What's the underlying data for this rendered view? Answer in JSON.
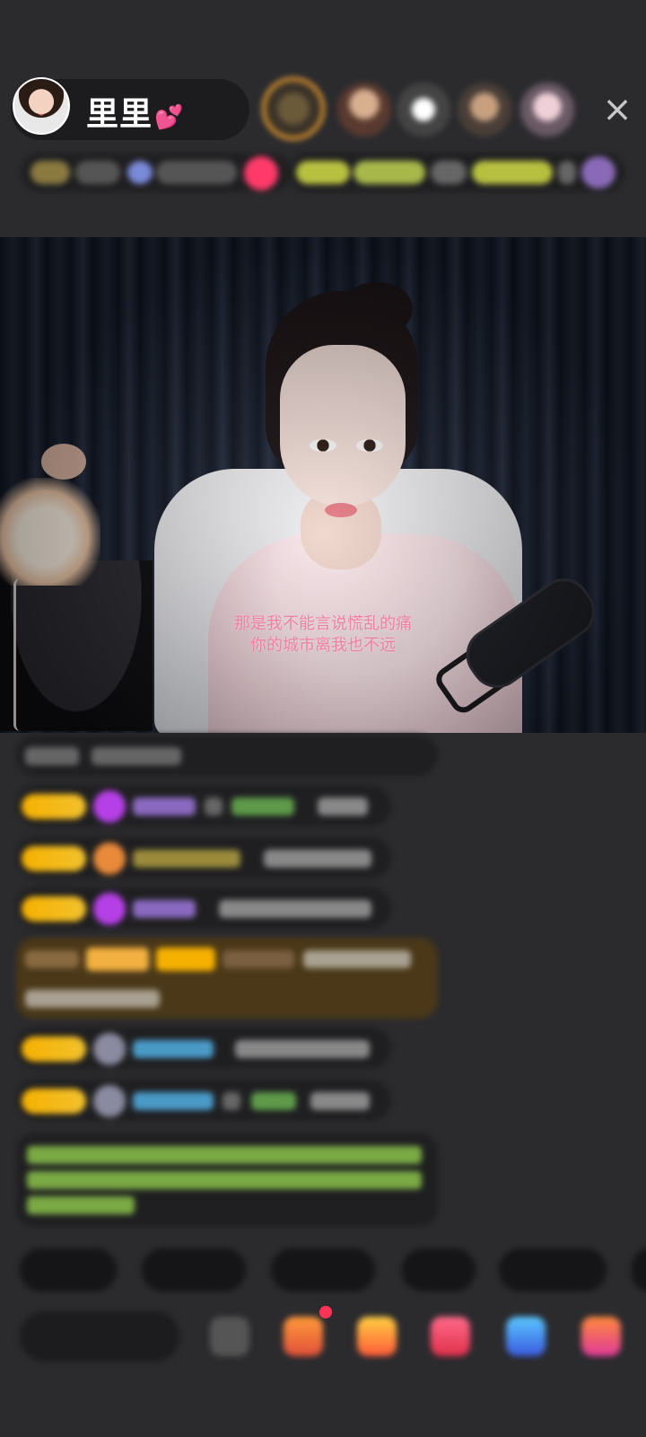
{
  "header": {
    "host_name": "里里",
    "host_name_emoji": "💕",
    "close_label": "×"
  },
  "video": {
    "lyrics": [
      "那是我不能言说慌乱的痛",
      "你的城市离我也不远"
    ]
  },
  "colors": {
    "background": "#2b2b2e",
    "level_badge": "#f6b100",
    "lyric_pink": "#f07fa6",
    "system_message_green": "#8bc34a",
    "gift_row_brown": "#4a3818"
  },
  "icons": {
    "close": "close-icon",
    "emoji": "emoji-icon",
    "gift": "gift-icon",
    "fan_club": "fan-club-icon",
    "heart": "heart-icon",
    "game": "game-icon",
    "more": "more-icon"
  }
}
